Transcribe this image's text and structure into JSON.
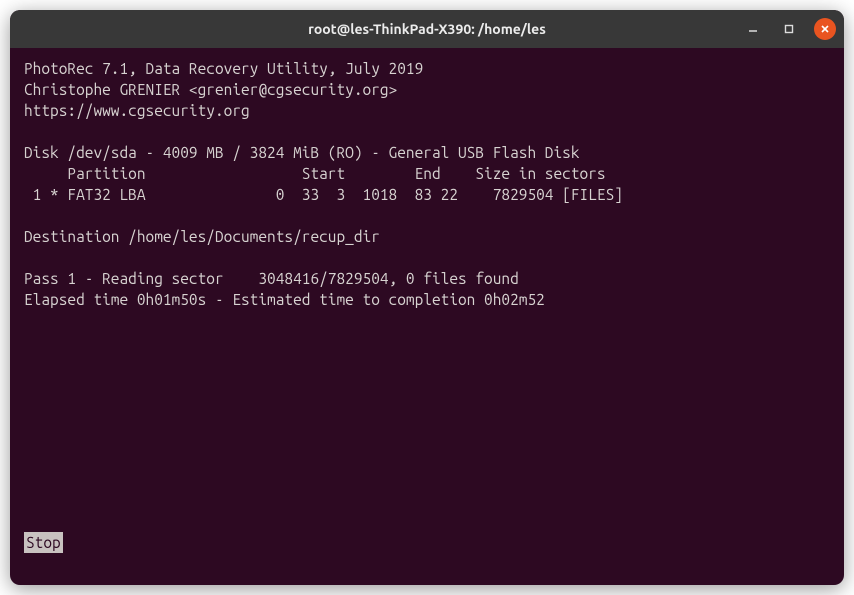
{
  "window": {
    "title": "root@les-ThinkPad-X390: /home/les"
  },
  "app": {
    "name_line": "PhotoRec 7.1, Data Recovery Utility, July 2019",
    "author_line": "Christophe GRENIER <grenier@cgsecurity.org>",
    "url_line": "https://www.cgsecurity.org"
  },
  "disk": {
    "line": "Disk /dev/sda - 4009 MB / 3824 MiB (RO) - General USB Flash Disk",
    "header": "     Partition                  Start        End    Size in sectors",
    "row": " 1 * FAT32 LBA               0  33  3  1018  83 22    7829504 [FILES]"
  },
  "destination": {
    "line": "Destination /home/les/Documents/recup_dir"
  },
  "progress": {
    "pass_line": "Pass 1 - Reading sector    3048416/7829504, 0 files found",
    "time_line": "Elapsed time 0h01m50s - Estimated time to completion 0h02m52"
  },
  "button": {
    "stop": " Stop "
  }
}
